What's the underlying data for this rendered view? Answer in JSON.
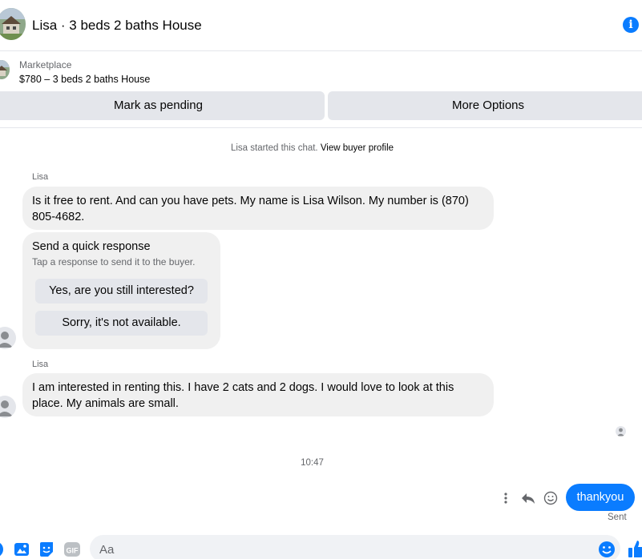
{
  "header": {
    "title": "Lisa · 3 beds 2 baths House",
    "info_icon": "info-icon"
  },
  "marketplace": {
    "label": "Marketplace",
    "listing": "$780 – 3 beds 2 baths House"
  },
  "actions": {
    "pending_label": "Mark as pending",
    "options_label": "More Options"
  },
  "chat": {
    "system_prefix": "Lisa started this chat.",
    "system_link": "View buyer profile",
    "messages": [
      {
        "sender": "Lisa",
        "text": "Is it free to rent. And can you have pets. My name is Lisa Wilson. My number is (870) 805-4682."
      },
      {
        "sender": "Lisa",
        "text": "I am interested in renting this. I have 2 cats and 2 dogs. I would love to look at this place. My animals are small."
      }
    ],
    "quick_response": {
      "title": "Send a quick response",
      "subtitle": "Tap a response to send it to the buyer.",
      "options": [
        "Yes, are you still interested?",
        "Sorry, it's not available."
      ]
    },
    "timestamp": "10:47",
    "sent_message": {
      "text": "thankyou",
      "status": "Sent"
    }
  },
  "composer": {
    "placeholder": "Aa",
    "icons": [
      "plus-circle-icon",
      "photo-icon",
      "sticker-icon",
      "gif-icon",
      "emoji-icon",
      "like-icon"
    ]
  },
  "colors": {
    "accent": "#0a7cff",
    "bubble_gray": "#f0f0f0",
    "button_gray": "#e4e6eb",
    "secondary_text": "#65676b"
  }
}
